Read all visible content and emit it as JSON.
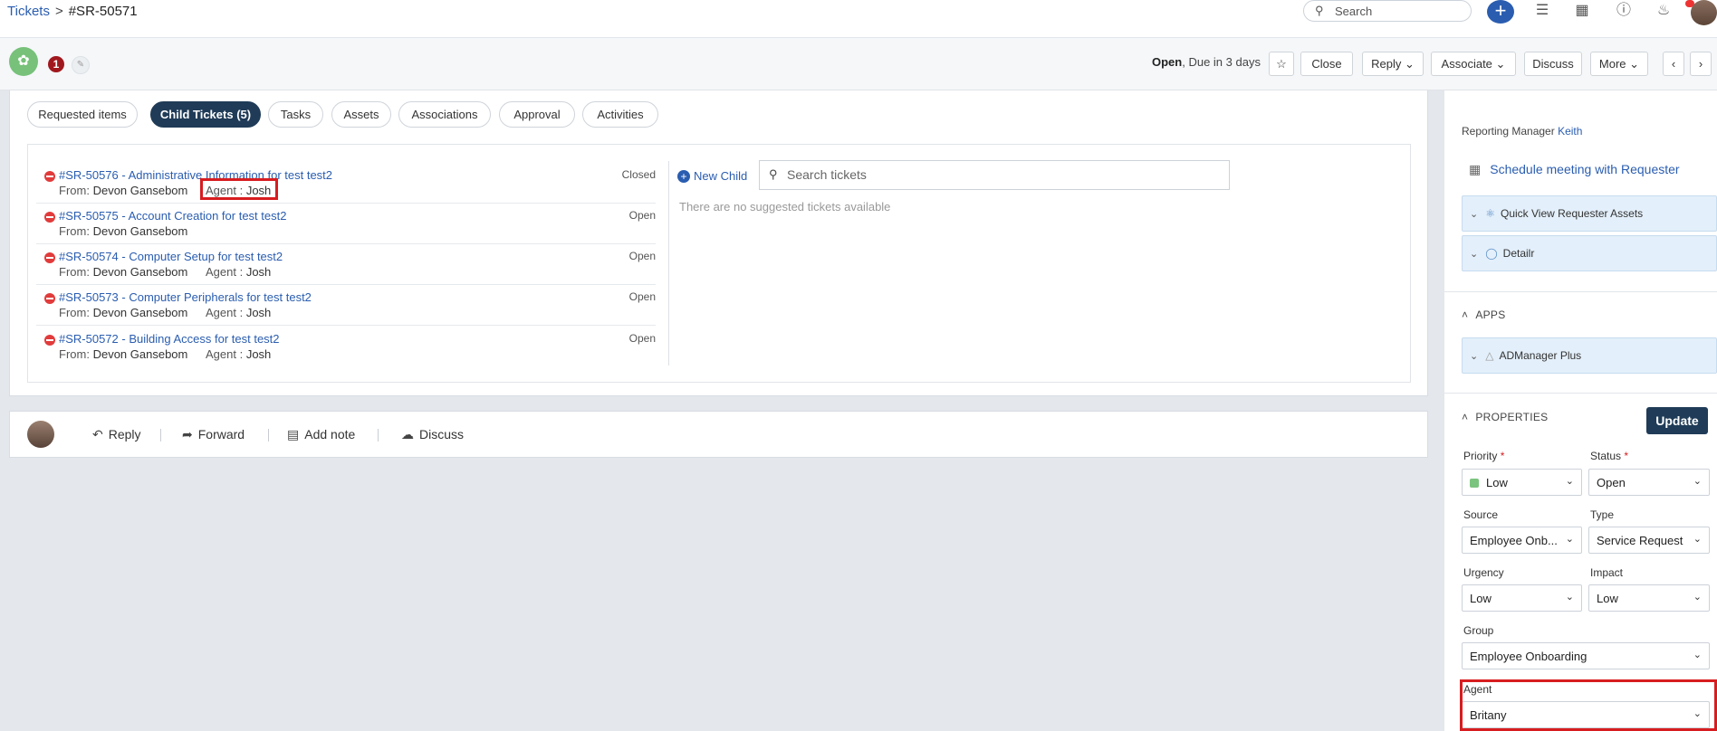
{
  "breadcrumb": {
    "root": "Tickets",
    "separator": ">",
    "current": "#SR-50571"
  },
  "topbar": {
    "search_placeholder": "Search",
    "add_label": "+"
  },
  "header": {
    "count_badge": "1",
    "status": "Open",
    "due": ", Due in 3 days",
    "buttons": {
      "close": "Close",
      "reply": "Reply",
      "associate": "Associate",
      "discuss": "Discuss",
      "more": "More"
    }
  },
  "tabs": [
    {
      "label": "Requested items"
    },
    {
      "label": "Child Tickets (5)"
    },
    {
      "label": "Tasks"
    },
    {
      "label": "Assets"
    },
    {
      "label": "Associations"
    },
    {
      "label": "Approval"
    },
    {
      "label": "Activities"
    }
  ],
  "child_tickets": [
    {
      "title": "#SR-50576 - Administrative Information for test test2",
      "from_label": "From:",
      "from": "Devon Gansebom",
      "agent_label": "Agent :",
      "agent": "Josh",
      "status": "Closed"
    },
    {
      "title": "#SR-50575 - Account Creation for test test2",
      "from_label": "From:",
      "from": "Devon Gansebom",
      "agent_label": "",
      "agent": "",
      "status": "Open"
    },
    {
      "title": "#SR-50574 - Computer Setup for test test2",
      "from_label": "From:",
      "from": "Devon Gansebom",
      "agent_label": "Agent :",
      "agent": "Josh",
      "status": "Open"
    },
    {
      "title": "#SR-50573 - Computer Peripherals for test test2",
      "from_label": "From:",
      "from": "Devon Gansebom",
      "agent_label": "Agent :",
      "agent": "Josh",
      "status": "Open"
    },
    {
      "title": "#SR-50572 - Building Access for test test2",
      "from_label": "From:",
      "from": "Devon Gansebom",
      "agent_label": "Agent :",
      "agent": "Josh",
      "status": "Open"
    }
  ],
  "suggest": {
    "new_child": "New Child",
    "search_placeholder": "Search tickets",
    "empty": "There are no suggested tickets available"
  },
  "reply_bar": {
    "reply": "Reply",
    "forward": "Forward",
    "add_note": "Add note",
    "discuss": "Discuss"
  },
  "right_panel": {
    "reporting_manager_label": "Reporting Manager",
    "reporting_manager": "Keith",
    "schedule": "Schedule meeting with Requester",
    "quick_view": "Quick View Requester Assets",
    "detailr": "Detailr",
    "apps_title": "APPS",
    "admanager": "ADManager Plus",
    "properties_title": "PROPERTIES",
    "update": "Update",
    "fields": {
      "priority": {
        "label": "Priority",
        "value": "Low"
      },
      "status": {
        "label": "Status",
        "value": "Open"
      },
      "source": {
        "label": "Source",
        "value": "Employee Onb..."
      },
      "type": {
        "label": "Type",
        "value": "Service Request"
      },
      "urgency": {
        "label": "Urgency",
        "value": "Low"
      },
      "impact": {
        "label": "Impact",
        "value": "Low"
      },
      "group": {
        "label": "Group",
        "value": "Employee Onboarding"
      },
      "agent": {
        "label": "Agent",
        "value": "Britany"
      }
    }
  },
  "colors": {
    "accent": "#2a5db0",
    "dark": "#1f3b57",
    "highlight": "#d71d20"
  }
}
